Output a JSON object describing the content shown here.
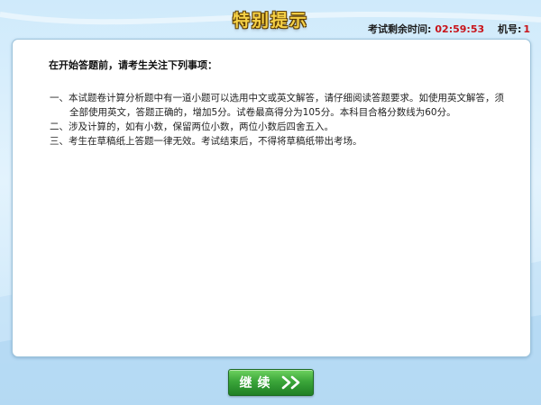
{
  "header": {
    "title": "特别提示",
    "timer_label": "考试剩余时间:",
    "timer_value": "02:59:53",
    "machine_label": "机号:",
    "machine_value": "1"
  },
  "notice": {
    "intro": "在开始答题前，请考生关注下列事项：",
    "rules": [
      "一、本试题卷计算分析题中有一道小题可以选用中文或英文解答，请仔细阅读答题要求。如使用英文解答，须全部使用英文，答题正确的，增加5分。试卷最高得分为105分。本科目合格分数线为60分。",
      "二、涉及计算的，如有小数，保留两位小数，两位小数后四舍五入。",
      "三、考生在草稿纸上答题一律无效。考试结束后，不得将草稿纸带出考场。"
    ]
  },
  "footer": {
    "continue_label": "继续",
    "continue_icon": "double-chevron-right-icon"
  },
  "colors": {
    "title": "#f7d247",
    "timer": "#c8141b",
    "button": "#3ba63a",
    "background": "#d6eefb"
  }
}
